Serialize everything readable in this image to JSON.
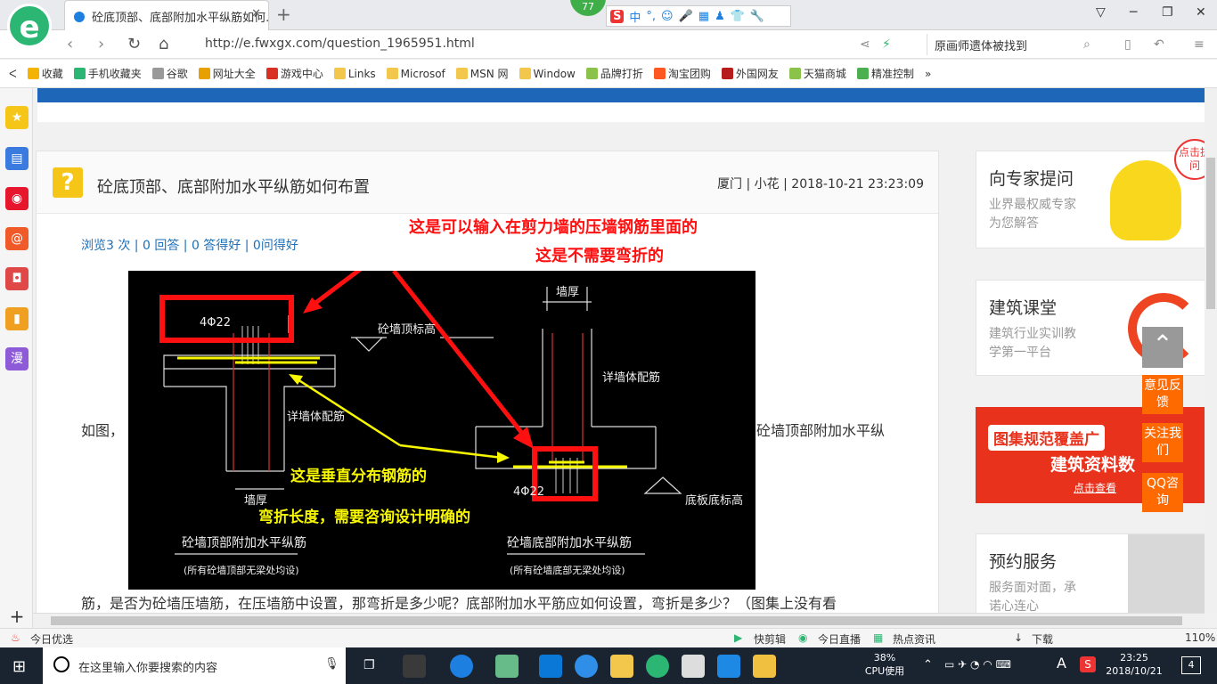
{
  "browser": {
    "logo_letter": "e",
    "tab_title": "砼底顶部、底部附加水平纵筋如何...",
    "tab_close": "✕",
    "newtab": "+",
    "badge_count": "77",
    "ime": {
      "logo": "S",
      "mode": "中",
      "punct": "°,"
    },
    "url": "http://e.fwxgx.com/question_1965951.html",
    "search_text": "原画师遗体被找到",
    "bookmarks": [
      {
        "label": "收藏",
        "color": "#f5b301"
      },
      {
        "label": "手机收藏夹",
        "color": "#2bb673"
      },
      {
        "label": "谷歌",
        "color": "#999999"
      },
      {
        "label": "网址大全",
        "color": "#e8a000"
      },
      {
        "label": "游戏中心",
        "color": "#d93025"
      },
      {
        "label": "Links",
        "color": "#f3c74c"
      },
      {
        "label": "Microsof",
        "color": "#f3c74c"
      },
      {
        "label": "MSN 网",
        "color": "#f3c74c"
      },
      {
        "label": "Window",
        "color": "#f3c74c"
      },
      {
        "label": "品牌打折",
        "color": "#8bc34a"
      },
      {
        "label": "淘宝团购",
        "color": "#ff5722"
      },
      {
        "label": "外国网友",
        "color": "#b71c1c"
      },
      {
        "label": "天猫商城",
        "color": "#8bc34a"
      },
      {
        "label": "精准控制",
        "color": "#4caf50"
      }
    ],
    "bookmarks_more": "»"
  },
  "question": {
    "icon": "?",
    "title": "砼底顶部、底部附加水平纵筋如何布置",
    "meta": "厦门 | 小花 | 2018-10-21 23:23:09",
    "stats": "浏览3 次 | 0 回答 | 0 答得好 | 0问得好",
    "text_left": "如图，",
    "text_right": "砼墙顶部附加水平纵",
    "text_bottom": "筋，是否为砼墙压墙筋，在压墙筋中设置，那弯折是多少呢？底部附加水平筋应如何设置，弯折是多少？（图集上没有看"
  },
  "drawing": {
    "annot_red_1": "这是可以输入在剪力墙的压墙钢筋里面的",
    "annot_red_2": "这是不需要弯折的",
    "annot_yellow_1": "这是垂直分布钢筋的",
    "annot_yellow_2": "弯折长度，需要咨询设计明确的",
    "label_4phi22_top": "4Φ22",
    "label_4phi22_bottom": "4Φ22",
    "label_wall_top_elev": "砼墙顶标高",
    "label_wall_thk_top": "墙厚",
    "label_wall_thk_bottom": "墙厚",
    "label_see_wall_rebar_1": "详墙体配筋",
    "label_see_wall_rebar_2": "详墙体配筋",
    "label_slab_bottom_elev": "底板底标高",
    "caption_left": "砼墙顶部附加水平纵筋",
    "caption_left_sub": "(所有砼墙顶部无梁处均设)",
    "caption_right": "砼墙底部附加水平纵筋",
    "caption_right_sub": "(所有砼墙底部无梁处均设)"
  },
  "right": {
    "card1_title": "向专家提问",
    "card1_desc1": "业界最权威专家",
    "card1_desc2": "为您解答",
    "card1_bubble": "点击提问",
    "card2_title": "建筑课堂",
    "card2_desc1": "建筑行业实训教",
    "card2_desc2": "学第一平台",
    "banner_line1": "图集规范覆盖广",
    "banner_line2": "建筑资料数",
    "banner_btn": "点击查看",
    "card3_title": "预约服务",
    "card3_desc1": "服务面对面，承",
    "card3_desc2": "诺心连心"
  },
  "float": {
    "feedback": "意见反馈",
    "follow": "关注我们",
    "qq": "QQ咨询"
  },
  "sidebar_plus": "+",
  "status": {
    "today": "今日优选",
    "quick": "快剪辑",
    "live": "今日直播",
    "news": "热点资讯",
    "download": "下载",
    "zoom": "110%"
  },
  "taskbar": {
    "search_placeholder": "在这里输入你要搜索的内容",
    "cpu": "38%",
    "cpu_label": "CPU使用",
    "ime": "A",
    "time": "23:25",
    "date": "2018/10/21",
    "notify": "4"
  }
}
